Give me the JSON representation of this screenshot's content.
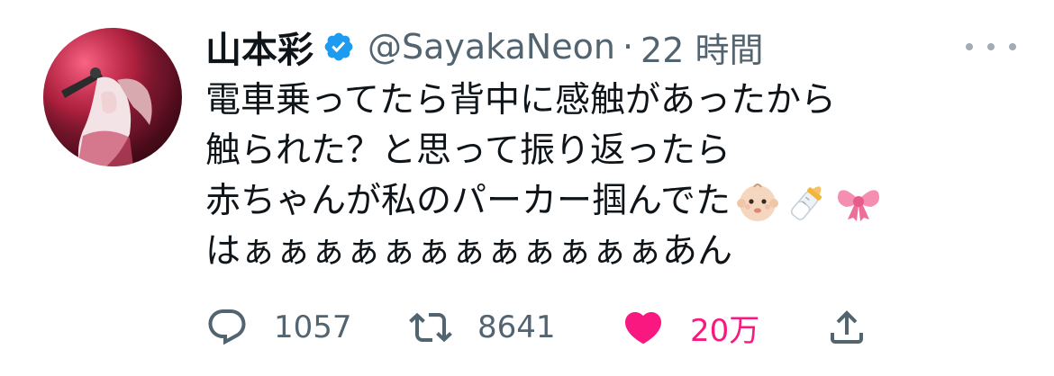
{
  "user": {
    "display_name": "山本彩",
    "handle": "@SayakaNeon",
    "separator": "·",
    "time": "22 時間",
    "verified": true
  },
  "tweet": {
    "lines": [
      "電車乗ってたら背中に感触があったから",
      "触られた？と思って振り返ったら",
      "赤ちゃんが私のパーカー掴んでた",
      "はぁぁぁぁぁぁぁぁぁぁぁぁあん"
    ],
    "emojis": [
      "baby",
      "baby-bottle",
      "ribbon"
    ]
  },
  "actions": {
    "reply_count": "1057",
    "retweet_count": "8641",
    "like_count": "20万",
    "liked": true
  },
  "colors": {
    "text": "#0f1419",
    "secondary": "#536471",
    "verified": "#1d9bf0",
    "like": "#f91880"
  },
  "icons": [
    "avatar",
    "verified-badge-icon",
    "more-icon",
    "reply-icon",
    "retweet-icon",
    "like-heart-icon",
    "share-icon"
  ]
}
